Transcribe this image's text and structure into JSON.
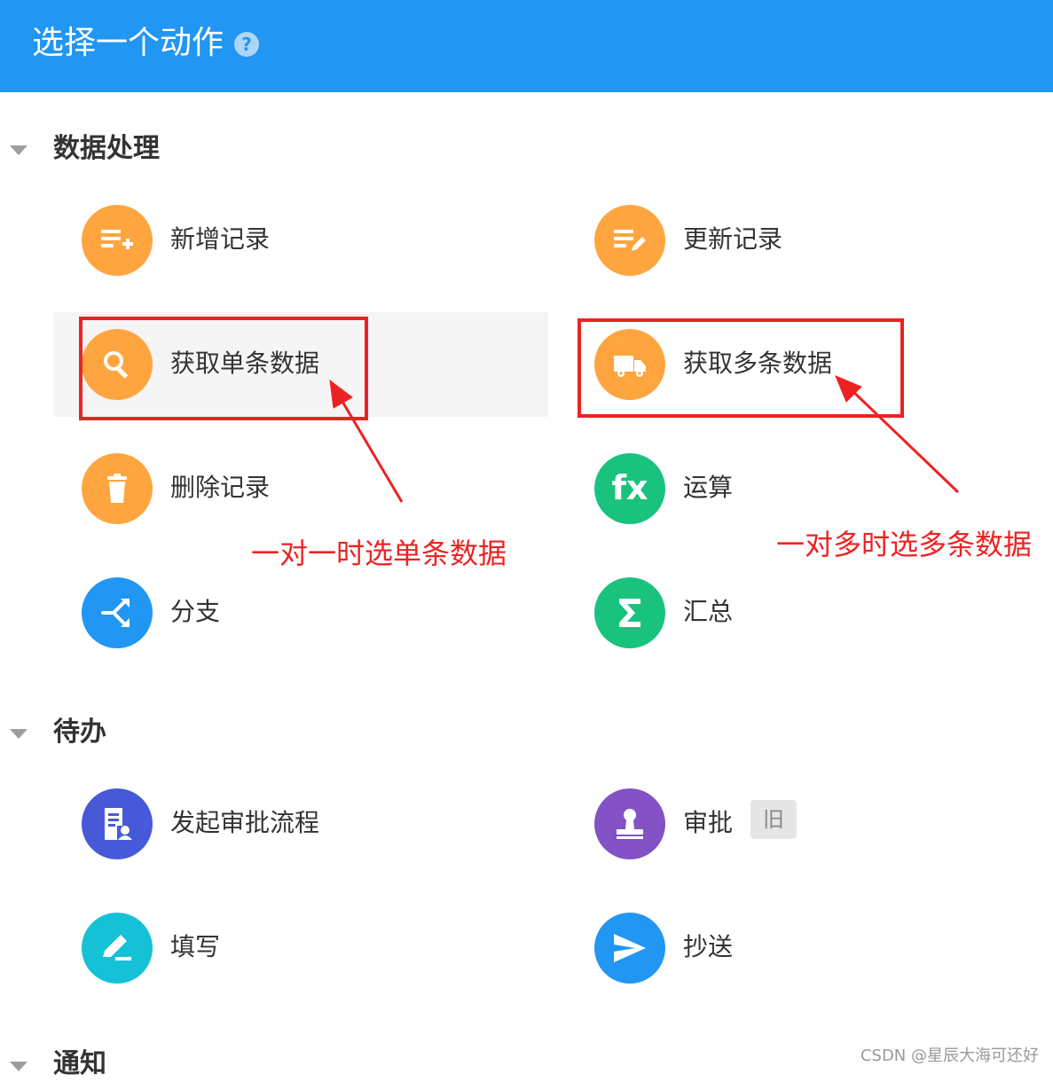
{
  "header": {
    "title": "选择一个动作",
    "help_glyph": "?"
  },
  "sections": [
    {
      "title": "数据处理",
      "items": [
        {
          "label": "新增记录",
          "icon": "add-list-icon",
          "color": "#ffa53f"
        },
        {
          "label": "更新记录",
          "icon": "edit-list-icon",
          "color": "#ffa53f"
        },
        {
          "label": "获取单条数据",
          "icon": "search-icon",
          "color": "#ffa53f"
        },
        {
          "label": "获取多条数据",
          "icon": "truck-icon",
          "color": "#ffa53f"
        },
        {
          "label": "删除记录",
          "icon": "trash-icon",
          "color": "#ffa53f"
        },
        {
          "label": "运算",
          "icon": "fx-icon",
          "glyph": "fx",
          "color": "#19c37d"
        },
        {
          "label": "分支",
          "icon": "branch-icon",
          "color": "#2196f3"
        },
        {
          "label": "汇总",
          "icon": "sigma-icon",
          "color": "#19c37d"
        }
      ]
    },
    {
      "title": "待办",
      "items": [
        {
          "label": "发起审批流程",
          "icon": "approval-doc-icon",
          "color": "#4759d8"
        },
        {
          "label": "审批",
          "icon": "stamp-icon",
          "color": "#8352c5",
          "badge": "旧"
        },
        {
          "label": "填写",
          "icon": "pencil-icon",
          "color": "#15c1d6"
        },
        {
          "label": "抄送",
          "icon": "send-icon",
          "color": "#2196f3"
        }
      ]
    },
    {
      "title": "通知",
      "items": []
    }
  ],
  "annotations": {
    "single": "一对一时选单条数据",
    "multi": "一对多时选多条数据",
    "color": "#ee2222"
  },
  "watermark": "CSDN @星辰大海可还好"
}
